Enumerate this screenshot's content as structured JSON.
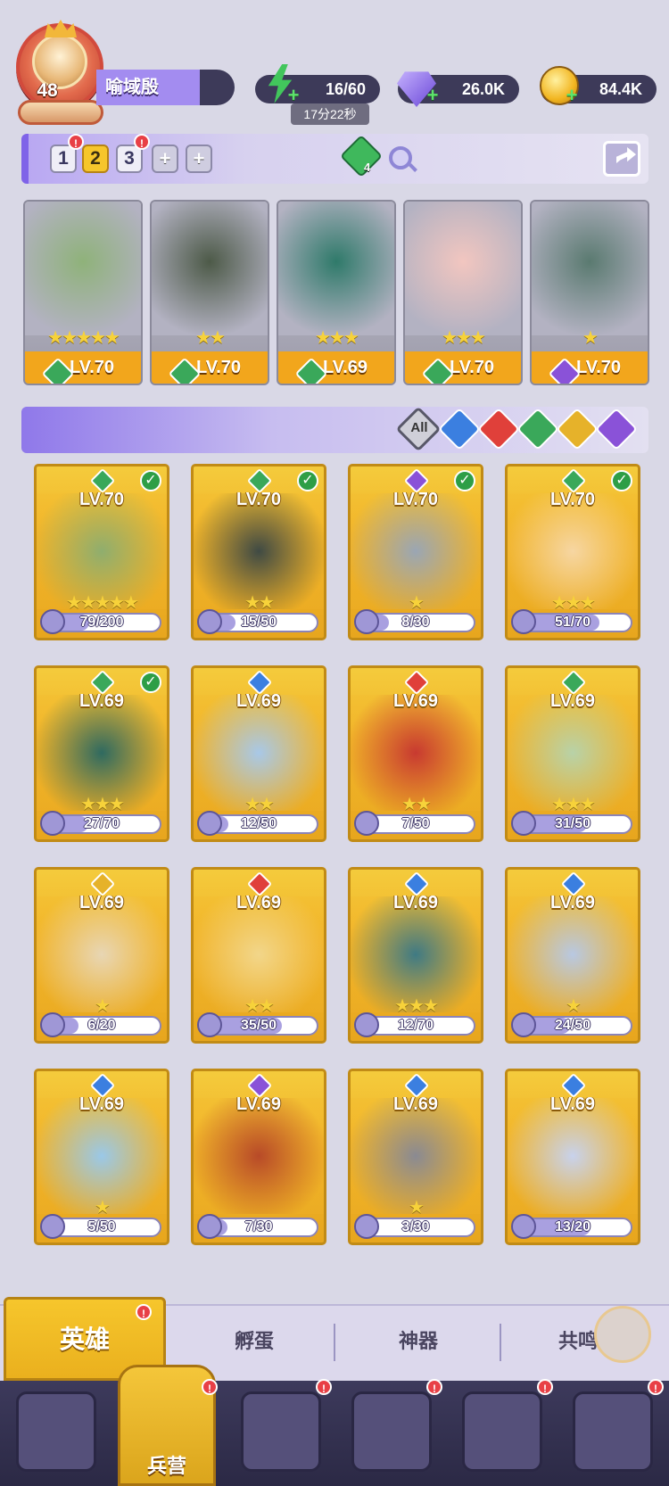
{
  "player": {
    "level": "48",
    "name": "喻域殷"
  },
  "resources": {
    "energy": "16/60",
    "energy_timer": "17分22秒",
    "gems": "26.0K",
    "coins": "84.4K"
  },
  "team_tabs": [
    "1",
    "2",
    "3"
  ],
  "team_synergy_count": "4",
  "team": [
    {
      "level": "LV.70",
      "stars": "★★★★★",
      "element": "earth"
    },
    {
      "level": "LV.70",
      "stars": "★★",
      "element": "earth"
    },
    {
      "level": "LV.69",
      "stars": "★★★",
      "element": "earth"
    },
    {
      "level": "LV.70",
      "stars": "★★★",
      "element": "earth"
    },
    {
      "level": "LV.70",
      "stars": "★",
      "element": "dark"
    }
  ],
  "filters": {
    "all_label": "All",
    "elements": [
      "water",
      "fire",
      "earth",
      "light",
      "dark"
    ]
  },
  "heroes": [
    {
      "level": "LV.70",
      "stars": "★★★★★",
      "fragments": "79/200",
      "frac": 0.395,
      "element": "earth",
      "in_team": true
    },
    {
      "level": "LV.70",
      "stars": "★★",
      "fragments": "15/50",
      "frac": 0.3,
      "element": "earth",
      "in_team": true
    },
    {
      "level": "LV.70",
      "stars": "★",
      "fragments": "8/30",
      "frac": 0.267,
      "element": "dark",
      "in_team": true
    },
    {
      "level": "LV.70",
      "stars": "★★★",
      "fragments": "51/70",
      "frac": 0.729,
      "element": "earth",
      "in_team": true
    },
    {
      "level": "LV.69",
      "stars": "★★★",
      "fragments": "27/70",
      "frac": 0.386,
      "element": "earth",
      "in_team": true
    },
    {
      "level": "LV.69",
      "stars": "★★",
      "fragments": "12/50",
      "frac": 0.24,
      "element": "water",
      "in_team": false
    },
    {
      "level": "LV.69",
      "stars": "★★",
      "fragments": "7/50",
      "frac": 0.14,
      "element": "fire",
      "in_team": false
    },
    {
      "level": "LV.69",
      "stars": "★★★",
      "fragments": "31/50",
      "frac": 0.62,
      "element": "earth",
      "in_team": false
    },
    {
      "level": "LV.69",
      "stars": "★",
      "fragments": "6/20",
      "frac": 0.3,
      "element": "light",
      "in_team": false
    },
    {
      "level": "LV.69",
      "stars": "★★",
      "fragments": "35/50",
      "frac": 0.7,
      "element": "fire",
      "in_team": false
    },
    {
      "level": "LV.69",
      "stars": "★★★",
      "fragments": "12/70",
      "frac": 0.171,
      "element": "water",
      "in_team": false
    },
    {
      "level": "LV.69",
      "stars": "★",
      "fragments": "24/50",
      "frac": 0.48,
      "element": "water",
      "in_team": false
    },
    {
      "level": "LV.69",
      "stars": "★",
      "fragments": "5/50",
      "frac": 0.1,
      "element": "water",
      "in_team": false
    },
    {
      "level": "LV.69",
      "stars": "",
      "fragments": "7/30",
      "frac": 0.233,
      "element": "dark",
      "in_team": false
    },
    {
      "level": "LV.69",
      "stars": "★",
      "fragments": "3/30",
      "frac": 0.1,
      "element": "water",
      "in_team": false
    },
    {
      "level": "LV.69",
      "stars": "",
      "fragments": "13/20",
      "frac": 0.65,
      "element": "water",
      "in_team": false
    }
  ],
  "subnav": {
    "heroes": "英雄",
    "incubate": "孵蛋",
    "artifacts": "神器",
    "resonance": "共鸣"
  },
  "bottomnav": {
    "barracks": "兵营"
  },
  "colors": {
    "earth": "#3aa85a",
    "water": "#3b7fe0",
    "fire": "#e0403a",
    "light": "#e6b22a",
    "dark": "#8a52d8",
    "card_gold": "#f2b52a",
    "accent_purple": "#8f78ea"
  }
}
